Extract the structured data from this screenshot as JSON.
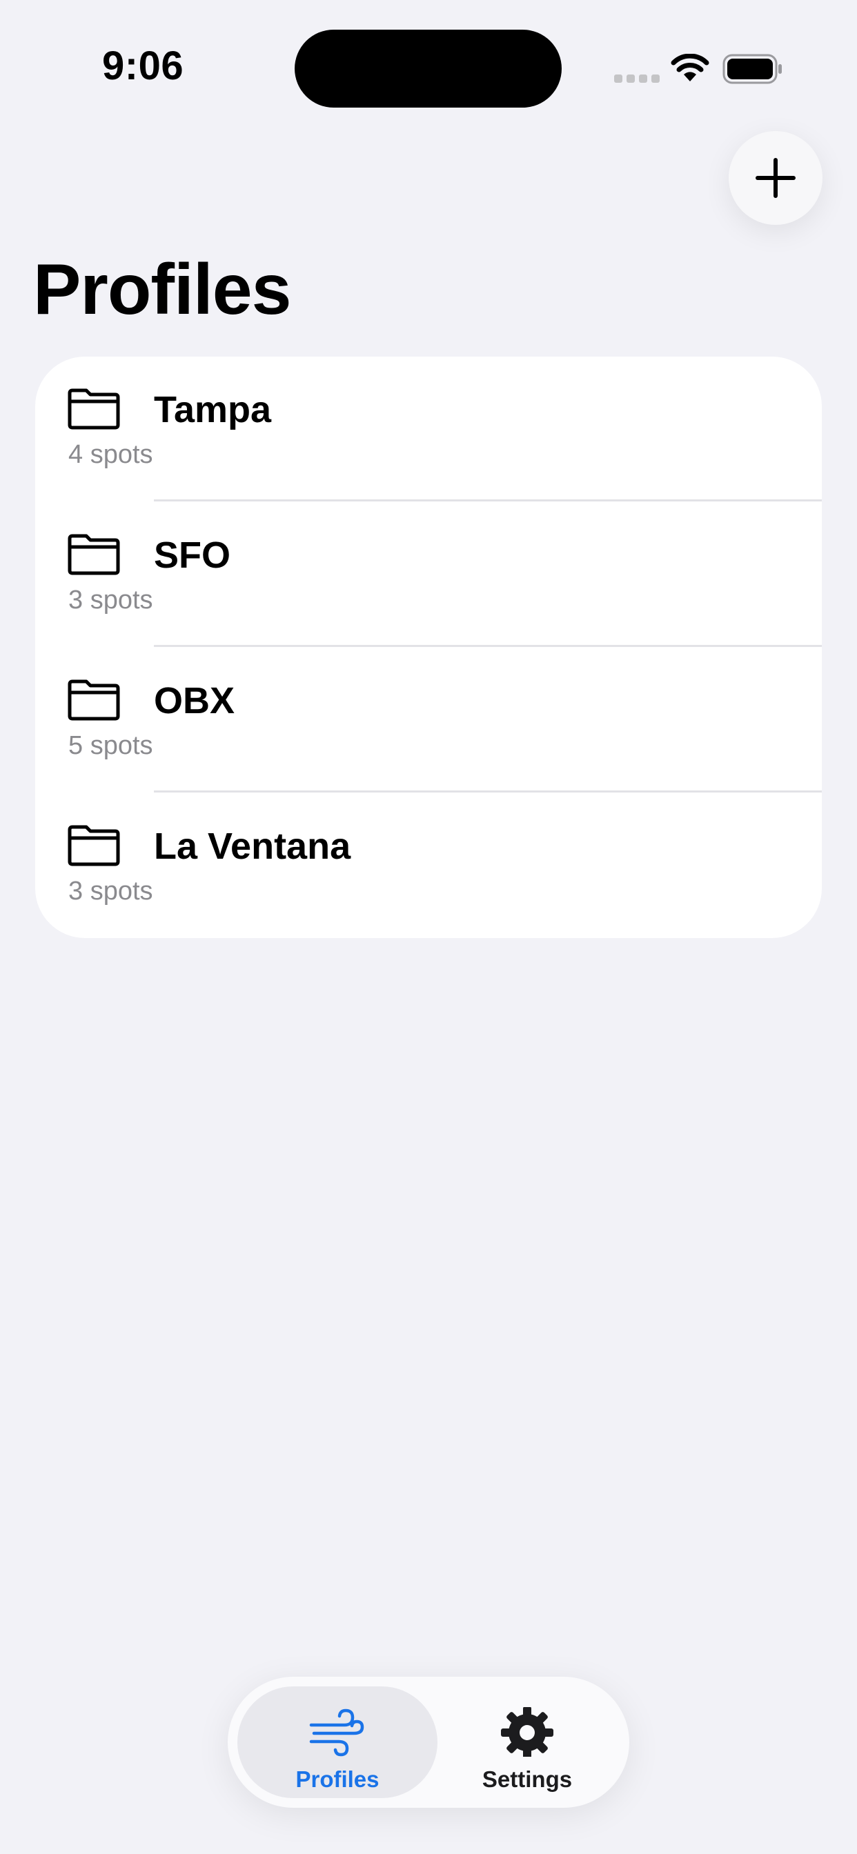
{
  "status_bar": {
    "time": "9:06"
  },
  "header": {
    "title": "Profiles",
    "add_icon": "plus-icon"
  },
  "profiles": [
    {
      "name": "Tampa",
      "count": "4 spots",
      "icon": "folder-icon"
    },
    {
      "name": "SFO",
      "count": "3 spots",
      "icon": "folder-icon"
    },
    {
      "name": "OBX",
      "count": "5 spots",
      "icon": "folder-icon"
    },
    {
      "name": "La Ventana",
      "count": "3 spots",
      "icon": "folder-icon"
    }
  ],
  "tab_bar": {
    "tabs": [
      {
        "label": "Profiles",
        "icon": "wind-icon",
        "selected": true
      },
      {
        "label": "Settings",
        "icon": "gear-icon",
        "selected": false
      }
    ]
  },
  "colors": {
    "background": "#f2f2f7",
    "card": "#ffffff",
    "accent": "#1a73e8",
    "secondary_text": "#8a8a8e"
  }
}
